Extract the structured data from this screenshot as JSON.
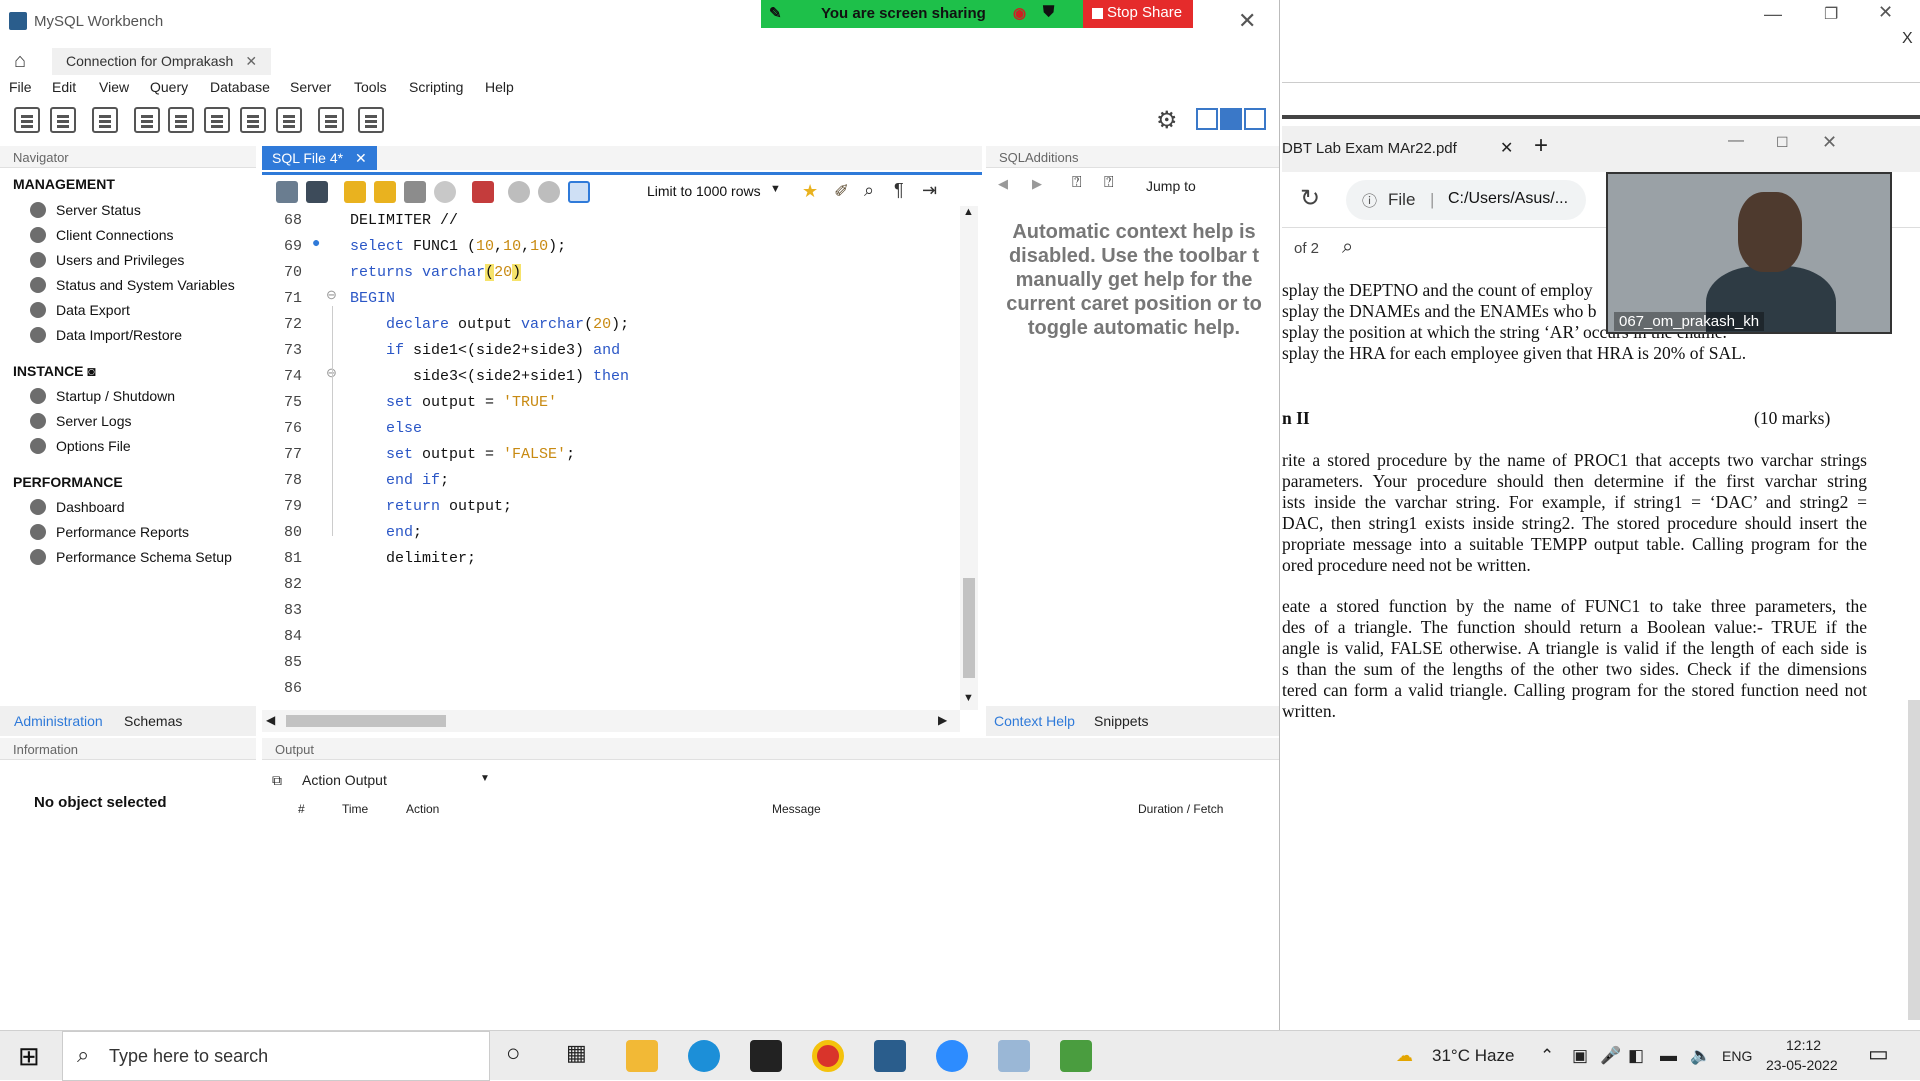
{
  "workbench": {
    "title": "MySQL Workbench",
    "connection_tab": "Connection for Omprakash",
    "menu": [
      "File",
      "Edit",
      "View",
      "Query",
      "Database",
      "Server",
      "Tools",
      "Scripting",
      "Help"
    ],
    "share": {
      "status": "You are screen sharing",
      "stop": "Stop Share"
    },
    "navigator": {
      "header": "Navigator",
      "management_title": "MANAGEMENT",
      "management": [
        "Server Status",
        "Client Connections",
        "Users and Privileges",
        "Status and System Variables",
        "Data Export",
        "Data Import/Restore"
      ],
      "instance_title": "INSTANCE",
      "instance": [
        "Startup / Shutdown",
        "Server Logs",
        "Options File"
      ],
      "performance_title": "PERFORMANCE",
      "performance": [
        "Dashboard",
        "Performance Reports",
        "Performance Schema Setup"
      ],
      "tabs": [
        "Administration",
        "Schemas"
      ]
    },
    "information": {
      "header": "Information",
      "message": "No object selected"
    },
    "editor": {
      "tab": "SQL File 4*",
      "limit": "Limit to 1000 rows",
      "lines": [
        {
          "n": "68",
          "code": "DELIMITER //"
        },
        {
          "n": "69",
          "code": "select FUNC1 (10,10,10);"
        },
        {
          "n": "70",
          "code": "returns varchar(20)"
        },
        {
          "n": "71",
          "code": "BEGIN"
        },
        {
          "n": "72",
          "code": "    declare output varchar(20);"
        },
        {
          "n": "73",
          "code": "    if side1<(side2+side3) and"
        },
        {
          "n": "74",
          "code": "       side3<(side2+side1) then"
        },
        {
          "n": "75",
          "code": "    set output = 'TRUE'"
        },
        {
          "n": "76",
          "code": "    else"
        },
        {
          "n": "77",
          "code": "    set output = 'FALSE';"
        },
        {
          "n": "78",
          "code": "    end if;"
        },
        {
          "n": "79",
          "code": "    return output;"
        },
        {
          "n": "80",
          "code": "    end;"
        },
        {
          "n": "81",
          "code": "    delimiter;"
        },
        {
          "n": "82",
          "code": ""
        },
        {
          "n": "83",
          "code": ""
        },
        {
          "n": "84",
          "code": ""
        },
        {
          "n": "85",
          "code": ""
        },
        {
          "n": "86",
          "code": ""
        }
      ]
    },
    "sql_additions": {
      "header": "SQLAdditions",
      "jump_to": "Jump to",
      "help_text": "Automatic context help is\ndisabled. Use the toolbar t\nmanually get help for the\ncurrent caret position or to\ntoggle automatic help.",
      "tabs": [
        "Context Help",
        "Snippets"
      ]
    },
    "output": {
      "header": "Output",
      "selector": "Action Output",
      "columns": [
        "#",
        "Time",
        "Action",
        "Message",
        "Duration / Fetch"
      ]
    }
  },
  "browser": {
    "close_x": "X",
    "tab_title": "DBT Lab Exam MAr22.pdf",
    "address_file": "File",
    "address_path": "C:/Users/Asus/...",
    "page_of": "of 2",
    "pdf_lines": [
      "splay the DEPTNO and the count of employ",
      "splay the DNAMEs and the ENAMEs who b",
      "splay the position at which the string ‘AR’ occurs in the ename.",
      "splay the HRA for each employee given that HRA is 20% of SAL."
    ],
    "section_title": "n II",
    "section_marks": "(10 marks)",
    "para1": [
      "rite a stored procedure by the name of PROC1 that accepts two varchar strings",
      "parameters. Your procedure should then determine if the first varchar string",
      "ists inside the varchar string. For example, if string1 = ‘DAC’ and string2 =",
      "DAC, then string1 exists inside string2.  The stored procedure should insert the",
      "propriate message into a suitable TEMPP output table. Calling program for the",
      "ored procedure need not be written."
    ],
    "para2": [
      "eate a stored function by the name of FUNC1 to take three parameters, the",
      "des of a triangle. The function should return a Boolean value:- TRUE if the",
      "angle is valid, FALSE otherwise. A triangle is valid if the length of each side is",
      "s than the sum of the lengths of the other two sides. Check if the dimensions",
      "tered can form a valid triangle. Calling program for the stored function need not",
      "written."
    ],
    "video_name": "067_om_prakash_kh"
  },
  "taskbar": {
    "search_placeholder": "Type here to search",
    "weather": "31°C  Haze",
    "lang": "ENG",
    "time": "12:12",
    "date": "23-05-2022"
  }
}
